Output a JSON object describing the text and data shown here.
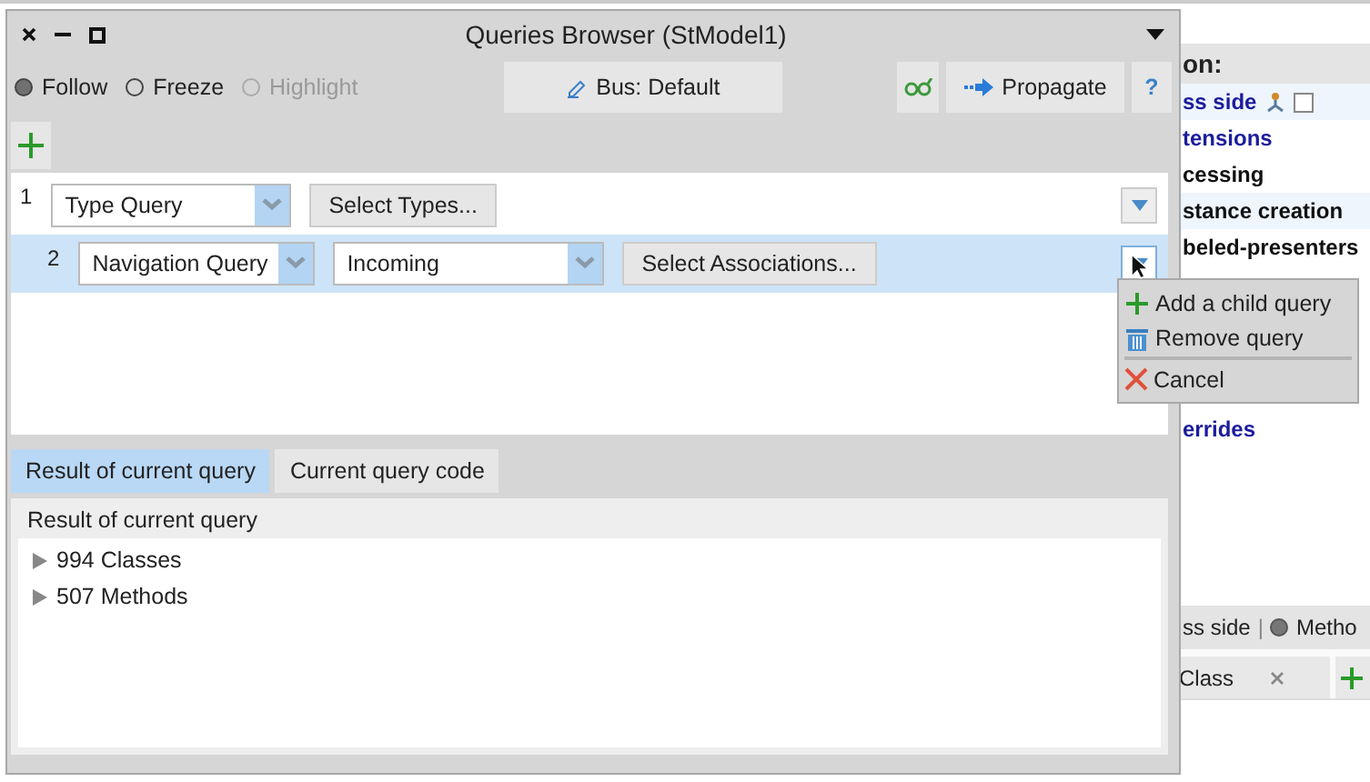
{
  "window": {
    "title": "Queries Browser (StModel1)"
  },
  "modes": [
    {
      "label": "Follow",
      "selected": true,
      "disabled": false
    },
    {
      "label": "Freeze",
      "selected": false,
      "disabled": false
    },
    {
      "label": "Highlight",
      "selected": false,
      "disabled": true
    }
  ],
  "bus_button": {
    "label": "Bus: Default"
  },
  "propagate_button": {
    "label": "Propagate"
  },
  "help_button": {
    "label": "?"
  },
  "queries": [
    {
      "number": "1",
      "type": "Type Query",
      "action": "Select Types...",
      "selected": false,
      "children": [
        {
          "number": "2",
          "type": "Navigation Query",
          "direction": "Incoming",
          "action": "Select Associations...",
          "selected": true
        }
      ]
    }
  ],
  "context_menu": {
    "items": [
      {
        "label": "Add a child query",
        "kind": "add"
      },
      {
        "label": "Remove query",
        "kind": "remove"
      },
      {
        "label": "Cancel",
        "kind": "cancel"
      }
    ]
  },
  "result_tabs": [
    {
      "label": "Result of current query",
      "selected": true
    },
    {
      "label": "Current query code",
      "selected": false
    }
  ],
  "result": {
    "header": "Result of current query",
    "items": [
      {
        "label": "994 Classes",
        "expanded": false
      },
      {
        "label": "507 Methods",
        "expanded": false
      }
    ]
  },
  "background_window": {
    "section_title": "on:",
    "protocols": [
      {
        "label": "ss side",
        "kind": "extension",
        "checkbox": {
          "checked": false
        }
      },
      {
        "label": "tensions",
        "kind": "extension"
      },
      {
        "label": "cessing",
        "kind": "local"
      },
      {
        "label": "stance creation",
        "kind": "local"
      },
      {
        "label": "beled-presenters",
        "kind": "local"
      },
      {
        "label": "errides",
        "kind": "extension",
        "hidden_before": true
      }
    ],
    "side_label": "ss side",
    "separator": "|",
    "method_radio": {
      "label": "Metho",
      "selected": true
    },
    "tabs": [
      {
        "label": "Class"
      }
    ]
  }
}
